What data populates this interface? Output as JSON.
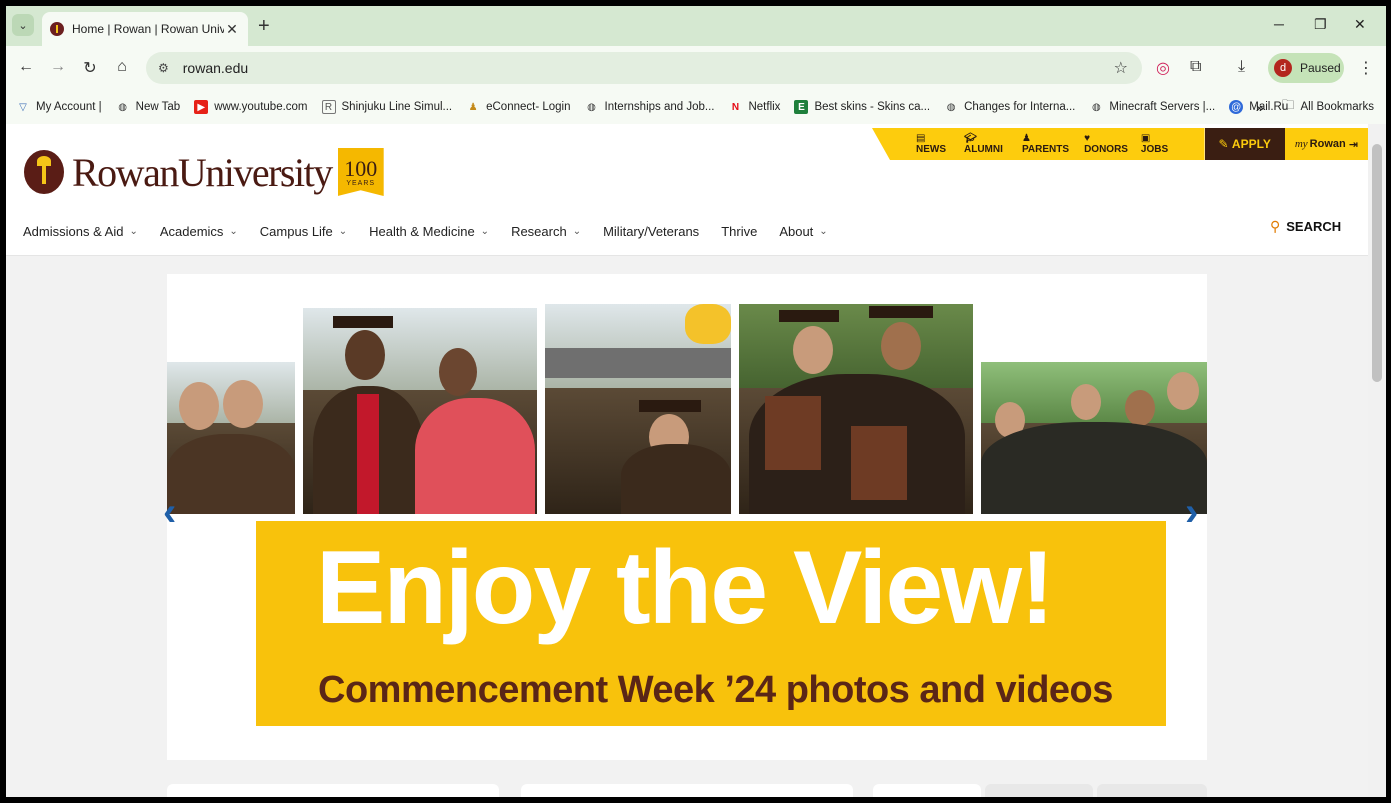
{
  "browser": {
    "tab": {
      "title": "Home | Rowan | Rowan Universi",
      "close": "✕"
    },
    "new_tab": "+",
    "window_controls": {
      "minimize": "─",
      "restore": "❐",
      "close": "✕"
    },
    "url": "rowan.edu",
    "profile": {
      "initial": "d",
      "status": "Paused"
    },
    "bookmarks": [
      {
        "label": "My Account |",
        "icon": "shield-icon"
      },
      {
        "label": "New Tab",
        "icon": "globe-icon"
      },
      {
        "label": "www.youtube.com",
        "icon": "youtube-icon"
      },
      {
        "label": "Shinjuku Line Simul...",
        "icon": "page-icon"
      },
      {
        "label": "eConnect- Login",
        "icon": "person-icon"
      },
      {
        "label": "Internships and Job...",
        "icon": "globe-icon"
      },
      {
        "label": "Netflix",
        "icon": "netflix-icon"
      },
      {
        "label": "Best skins - Skins ca...",
        "icon": "e-icon"
      },
      {
        "label": "Changes for Interna...",
        "icon": "globe-icon"
      },
      {
        "label": "Minecraft Servers |...",
        "icon": "globe-icon"
      },
      {
        "label": "Mail.Ru",
        "icon": "mail-icon"
      }
    ],
    "bookmarks_overflow": "»",
    "all_bookmarks": "All Bookmarks"
  },
  "site": {
    "utility": {
      "news": "NEWS",
      "alumni": "ALUMNI",
      "parents": "PARENTS",
      "donors": "DONORS",
      "jobs": "JOBS",
      "apply": "APPLY",
      "my_prefix": "my",
      "my_rowan": "Rowan"
    },
    "logo": {
      "wordmark": "RowanUniversity",
      "badge_number": "100",
      "badge_text": "YEARS"
    },
    "nav": [
      {
        "label": "Admissions & Aid",
        "dropdown": true
      },
      {
        "label": "Academics",
        "dropdown": true
      },
      {
        "label": "Campus Life",
        "dropdown": true
      },
      {
        "label": "Health & Medicine",
        "dropdown": true
      },
      {
        "label": "Research",
        "dropdown": true
      },
      {
        "label": "Military/Veterans",
        "dropdown": false
      },
      {
        "label": "Thrive",
        "dropdown": false
      },
      {
        "label": "About",
        "dropdown": true
      }
    ],
    "search_label": "SEARCH",
    "hero": {
      "headline": "Enjoy the View!",
      "subheadline": "Commencement Week ’24 photos and videos"
    }
  },
  "colors": {
    "rowan_brown": "#4a1a12",
    "rowan_gold": "#fdcc0d",
    "carousel_arrow": "#1f5fa8"
  }
}
